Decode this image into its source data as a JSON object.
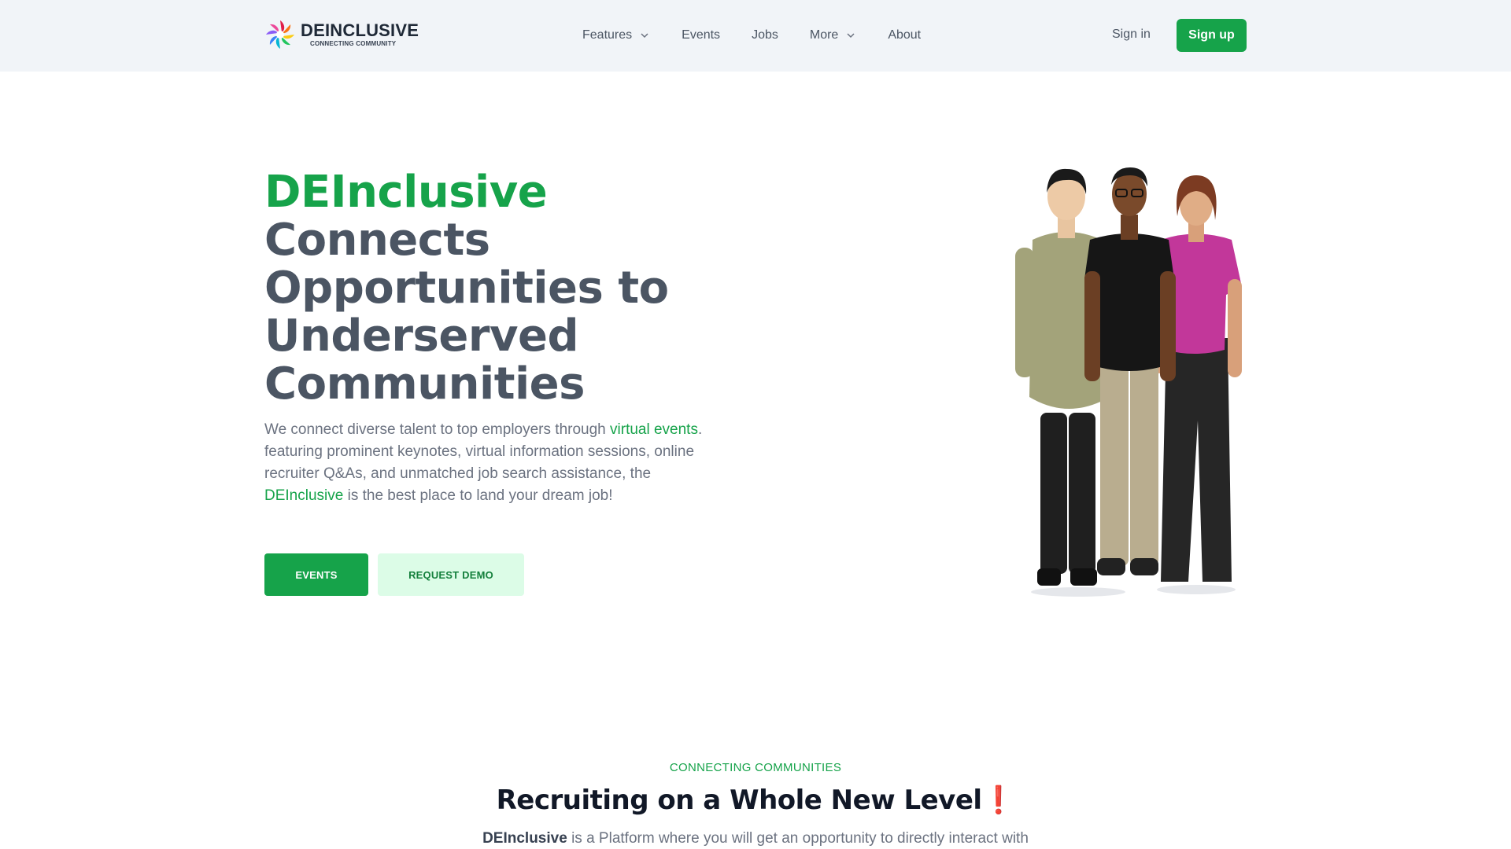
{
  "header": {
    "logo_name": "DEINCLUSIVE",
    "logo_tagline": "CONNECTING COMMUNITY",
    "nav": [
      {
        "label": "Features",
        "has_dropdown": true
      },
      {
        "label": "Events",
        "has_dropdown": false
      },
      {
        "label": "Jobs",
        "has_dropdown": false
      },
      {
        "label": "More",
        "has_dropdown": true
      },
      {
        "label": "About",
        "has_dropdown": false
      }
    ],
    "sign_in": "Sign in",
    "sign_up": "Sign up"
  },
  "hero": {
    "title_brand": "DEInclusive",
    "title_rest": "Connects Opportunities to Underserved Communities",
    "desc_1": "We connect diverse talent to top employers through ",
    "desc_link_1": "virtual events",
    "desc_2": ". featuring prominent keynotes, virtual information sessions, online recruiter Q&As, and unmatched job search assistance, the ",
    "desc_link_2": "DEInclusive",
    "desc_3": " is the best place to land your dream job!",
    "btn_events": "EVENTS",
    "btn_demo": "REQUEST DEMO"
  },
  "section": {
    "eyebrow": "CONNECTING COMMUNITIES",
    "title": "Recruiting on a Whole New Level",
    "title_mark": "❗",
    "body_brand": "DEInclusive",
    "body_rest": " is a Platform where you will get an opportunity to directly interact with"
  },
  "colors": {
    "accent": "#16a34a",
    "header_bg": "#f1f4f8",
    "demo_bg": "#dcfce7",
    "exclamation": "#e11d48"
  }
}
